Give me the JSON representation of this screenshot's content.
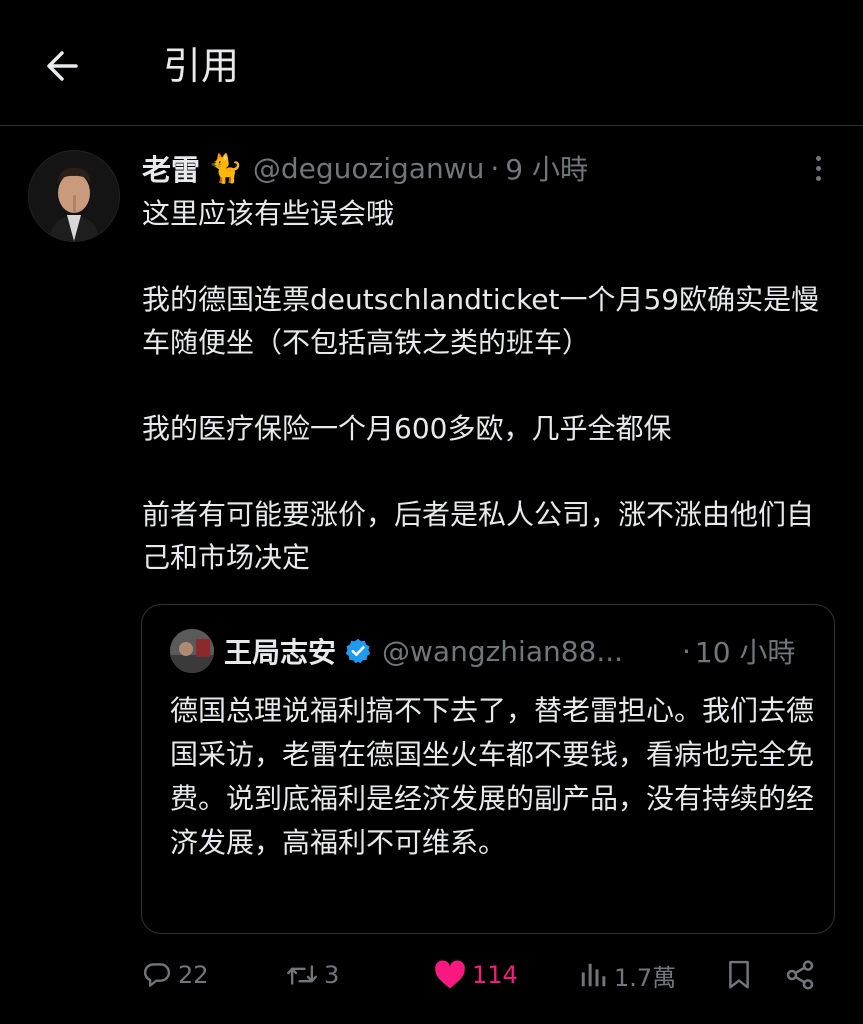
{
  "header": {
    "title": "引用"
  },
  "tweet": {
    "author_name": "老雷",
    "author_emoji": "🐈",
    "handle": "@deguoziganwu",
    "dot": "·",
    "time": "9 小時",
    "paragraphs": [
      "这里应该有些误会哦",
      "我的德国连票deutschlandticket一个月59欧确实是慢车随便坐（不包括高铁之类的班车）",
      "我的医疗保险一个月600多欧，几乎全都保",
      "前者有可能要涨价，后者是私人公司，涨不涨由他们自己和市场决定"
    ]
  },
  "quote": {
    "author_name": "王局志安",
    "handle": "@wangzhian88...",
    "dot": "·",
    "time": "10 小時",
    "text": "德国总理说福利搞不下去了，替老雷担心。我们去德国采访，老雷在德国坐火车都不要钱，看病也完全免费。说到底福利是经济发展的副产品，没有持续的经济发展，高福利不可维系。"
  },
  "actions": {
    "reply_count": "22",
    "retweet_count": "3",
    "like_count": "114",
    "views_count": "1.7萬"
  },
  "colors": {
    "background": "#000000",
    "text": "#e7e9ea",
    "muted": "#71767b",
    "like": "#f91880",
    "verified": "#1d9bf0"
  }
}
